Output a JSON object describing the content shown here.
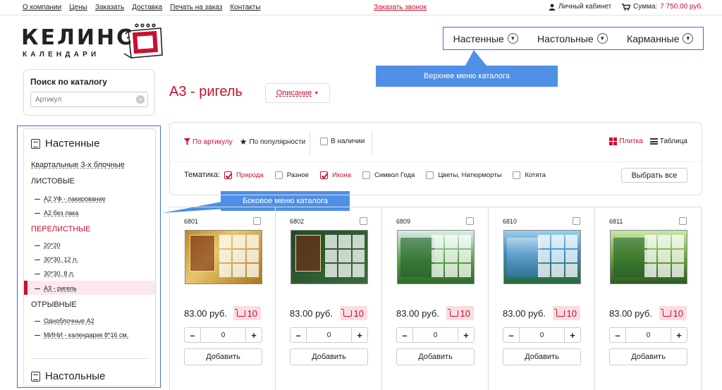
{
  "topbar": {
    "nav": [
      "О компании",
      "Цены",
      "Заказать",
      "Доставка",
      "Печать на заказ",
      "Контакты"
    ],
    "callback": "Заказать звонок",
    "account": "Личный кабинет",
    "cart_label": "Сумма:",
    "cart_amount": "7 750.00 руб."
  },
  "logo": {
    "title": "КЕЛИНС",
    "subtitle": "КАЛЕНДАРИ"
  },
  "top_menu": {
    "items": [
      "Настенные",
      "Настольные",
      "Карманные"
    ],
    "tooltip": "Верхнее меню каталога"
  },
  "search": {
    "title": "Поиск по каталогу",
    "placeholder": "Артикул"
  },
  "sidebar": {
    "heading": "Настенные",
    "link": "Квартальные 3-х блочные",
    "group1": "ЛИСТОВЫЕ",
    "group1_items": [
      "А2 УФ - лакирование",
      "А2 без лака"
    ],
    "group2": "ПЕРЕЛИСТНЫЕ",
    "group2_items": [
      "20*20",
      "30*30, 12 л.",
      "30*30, 8 л.",
      "А3 - ригель"
    ],
    "group3": "ОТРЫВНЫЕ",
    "group3_items": [
      "Одноблочные А2",
      "МИНИ - календарик 8*16 см."
    ],
    "heading2": "Настольные",
    "tooltip": "Боковое меню каталога"
  },
  "main": {
    "title": "А3 - ригель",
    "description_btn": "Описание"
  },
  "filters": {
    "sort_by_article": "По артикулу",
    "sort_by_popularity": "По популярности",
    "in_stock": "В наличии",
    "view_tile": "Плитка",
    "view_table": "Таблица",
    "theme_label": "Тематика:",
    "topics": [
      {
        "label": "Природа",
        "checked": true
      },
      {
        "label": "Разное",
        "checked": false
      },
      {
        "label": "Икона",
        "checked": true
      },
      {
        "label": "Символ Года",
        "checked": false
      },
      {
        "label": "Цветы, Натюрморты",
        "checked": false
      },
      {
        "label": "Котята",
        "checked": false
      }
    ],
    "select_all": "Выбрать все"
  },
  "products": [
    {
      "code": "6801",
      "price": "83.00 руб.",
      "stock": "10",
      "qty": "0",
      "add": "Добавить",
      "theme": "gold"
    },
    {
      "code": "6802",
      "price": "83.00 руб.",
      "stock": "10",
      "qty": "0",
      "add": "Добавить",
      "theme": "green"
    },
    {
      "code": "6809",
      "price": "83.00 руб.",
      "stock": "10",
      "qty": "0",
      "add": "Добавить",
      "theme": "nature1"
    },
    {
      "code": "6810",
      "price": "83.00 руб.",
      "stock": "10",
      "qty": "0",
      "add": "Добавить",
      "theme": "nature2"
    },
    {
      "code": "6811",
      "price": "83.00 руб.",
      "stock": "10",
      "qty": "0",
      "add": "Добавить",
      "theme": "nature3"
    }
  ],
  "stepper": {
    "minus": "–",
    "plus": "+"
  },
  "colors": {
    "accent": "#c8102e",
    "annotation": "#4f8fe6",
    "frame": "#3a6fd8"
  }
}
